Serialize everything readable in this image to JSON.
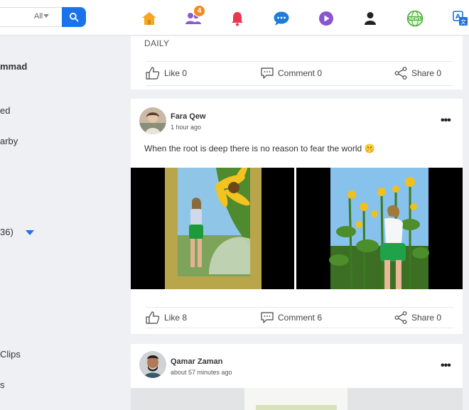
{
  "topbar": {
    "search_filter": "All",
    "notification_count": "4",
    "icons": [
      "home-icon",
      "friends-icon",
      "bell-icon",
      "chat-icon",
      "video-icon",
      "profile-icon",
      "news-icon",
      "translate-icon"
    ],
    "accent": "#1a73e8"
  },
  "sidebar": {
    "items": [
      {
        "label": "mmad",
        "bold": true
      },
      {
        "label": "ed"
      },
      {
        "label": "arby"
      },
      {
        "label": "36)"
      },
      {
        "label": "Clips"
      },
      {
        "label": "s"
      }
    ]
  },
  "posts": [
    {
      "text": "DAILY",
      "actions": {
        "like": "Like 0",
        "comment": "Comment 0",
        "share": "Share 0"
      }
    },
    {
      "author": "Fara Qew",
      "time": "1 hour ago",
      "text": "When the root is deep there is no reason to fear the world 🤫",
      "actions": {
        "like": "Like 8",
        "comment": "Comment 6",
        "share": "Share 0"
      }
    },
    {
      "author": "Qamar Zaman",
      "time": "about 57 minutes ago"
    }
  ]
}
